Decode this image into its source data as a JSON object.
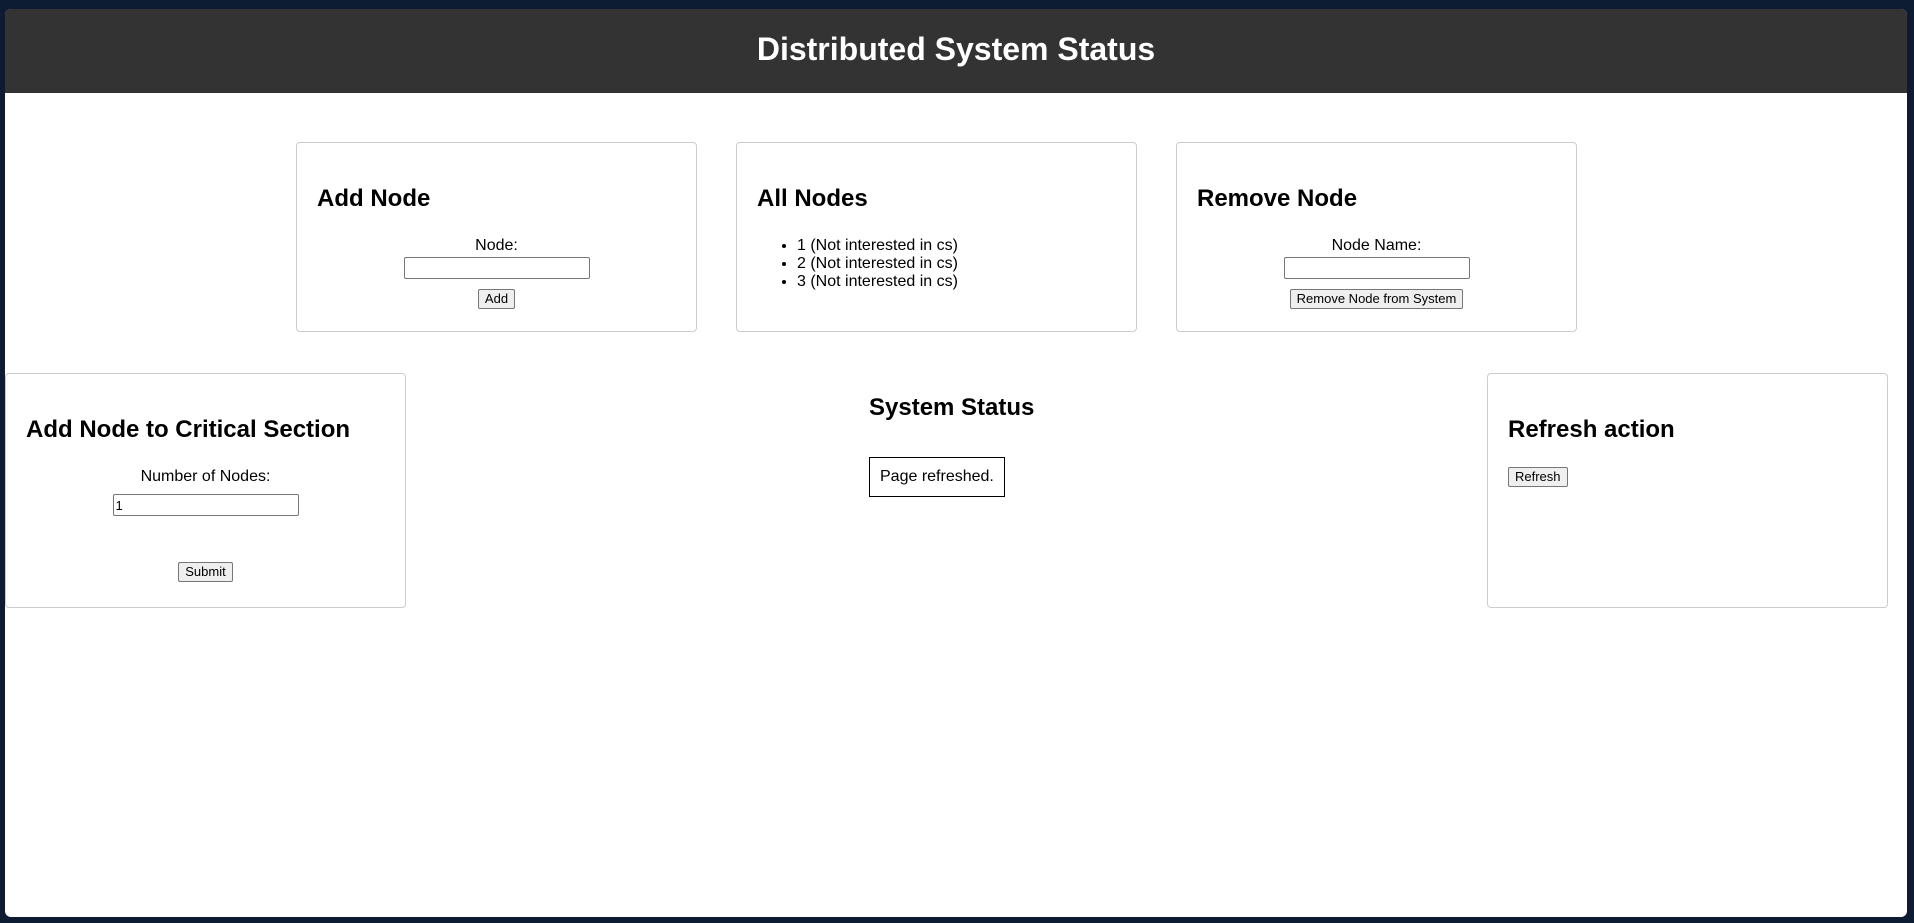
{
  "header": {
    "title": "Distributed System Status"
  },
  "add_node": {
    "title": "Add Node",
    "label": "Node:",
    "value": "",
    "button": "Add"
  },
  "all_nodes": {
    "title": "All Nodes",
    "items": [
      "1 (Not interested in cs)",
      "2 (Not interested in cs)",
      "3 (Not interested in cs)"
    ]
  },
  "remove_node": {
    "title": "Remove Node",
    "label": "Node Name:",
    "value": "",
    "button": "Remove Node from System"
  },
  "critical_section": {
    "title": "Add Node to Critical Section",
    "label": "Number of Nodes:",
    "value": "1",
    "button": "Submit"
  },
  "system_status": {
    "title": "System Status",
    "message": "Page refreshed."
  },
  "refresh": {
    "title": "Refresh action",
    "button": "Refresh"
  },
  "colors": {
    "header_bg": "#333333",
    "page_bg": "#ffffff",
    "desktop_bg": "#0d1b33"
  }
}
